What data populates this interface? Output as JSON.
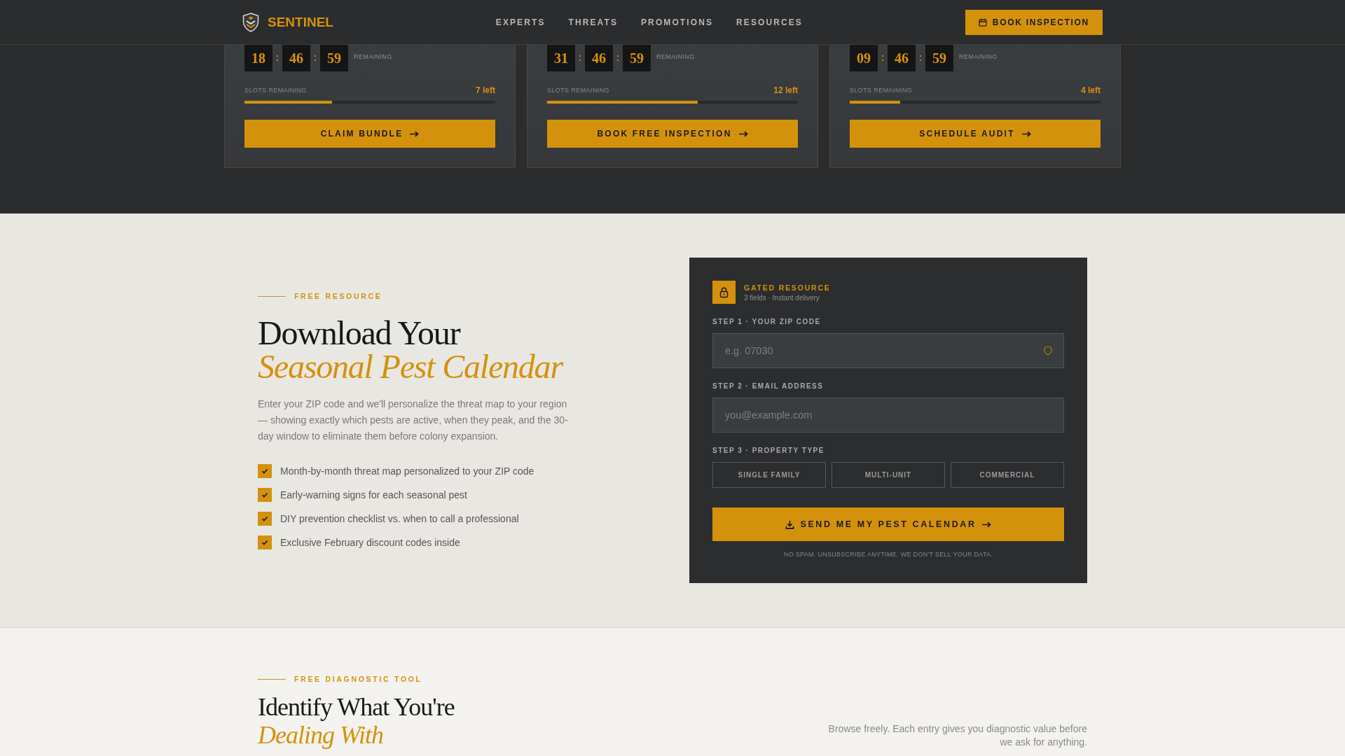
{
  "nav": {
    "brand": "SENTINEL",
    "links": [
      "EXPERTS",
      "THREATS",
      "PROMOTIONS",
      "RESOURCES"
    ],
    "cta": "BOOK INSPECTION"
  },
  "offers": [
    {
      "countdown": [
        {
          "kind": "unit",
          "text": "18"
        },
        {
          "kind": "separator",
          "text": ":"
        },
        {
          "kind": "unit",
          "text": "46"
        },
        {
          "kind": "separator",
          "text": ":"
        },
        {
          "kind": "unit",
          "text": "59"
        }
      ],
      "countdown_label": "REMAINING",
      "slots_label": "SLOTS REMAINING",
      "slots_left": "7 left",
      "level": 0.35,
      "button": "CLAIM BUNDLE"
    },
    {
      "countdown": [
        {
          "kind": "unit",
          "text": "31"
        },
        {
          "kind": "separator",
          "text": ":"
        },
        {
          "kind": "unit",
          "text": "46"
        },
        {
          "kind": "separator",
          "text": ":"
        },
        {
          "kind": "unit",
          "text": "59"
        }
      ],
      "countdown_label": "REMAINING",
      "slots_label": "SLOTS REMAINING",
      "slots_left": "12 left",
      "level": 0.6,
      "button": "BOOK FREE INSPECTION"
    },
    {
      "countdown": [
        {
          "kind": "unit",
          "text": "09"
        },
        {
          "kind": "separator",
          "text": ":"
        },
        {
          "kind": "unit",
          "text": "46"
        },
        {
          "kind": "separator",
          "text": ":"
        },
        {
          "kind": "unit",
          "text": "59"
        }
      ],
      "countdown_label": "REMAINING",
      "slots_label": "SLOTS REMAINING",
      "slots_left": "4 left",
      "level": 0.2,
      "button": "SCHEDULE AUDIT"
    }
  ],
  "lead_magnet": {
    "eyebrow": "FREE RESOURCE",
    "title": "Download Your",
    "title_accent": "Seasonal Pest Calendar",
    "description": "Enter your ZIP code and we'll personalize the threat map to your region — showing exactly which pests are active, when they peak, and the 30-day window to eliminate them before colony expansion.",
    "benefits": [
      {
        "text": "Month-by-month threat map personalized to your ZIP code",
        "checked": true
      },
      {
        "text": "Early-warning signs for each seasonal pest",
        "checked": true
      },
      {
        "text": "DIY prevention checklist vs. when to call a professional",
        "checked": true
      },
      {
        "text": "Exclusive February discount codes inside",
        "checked": true
      }
    ]
  },
  "form": {
    "badge_title": "GATED RESOURCE",
    "badge_subtitle": "3 fields · Instant delivery",
    "fields": [
      {
        "kind": "zip",
        "label": "STEP 1 · YOUR ZIP CODE",
        "placeholder": "e.g. 07030"
      },
      {
        "kind": "email",
        "label": "STEP 2 · EMAIL ADDRESS",
        "placeholder": "you@example.com"
      }
    ],
    "property_label": "STEP 3 · PROPERTY TYPE",
    "property_types": [
      {
        "label": "SINGLE FAMILY",
        "selected": false
      },
      {
        "label": "MULTI-UNIT",
        "selected": false
      },
      {
        "label": "COMMERCIAL",
        "selected": false
      }
    ],
    "submit": "SEND ME MY PEST CALENDAR",
    "disclaimer": "NO SPAM. UNSUBSCRIBE ANYTIME. WE DON'T SELL YOUR DATA."
  },
  "diagnostic": {
    "eyebrow": "FREE DIAGNOSTIC TOOL",
    "title": "Identify What You're",
    "title_accent": "Dealing With",
    "description": "Browse freely. Each entry gives you diagnostic value before we ask for anything."
  }
}
